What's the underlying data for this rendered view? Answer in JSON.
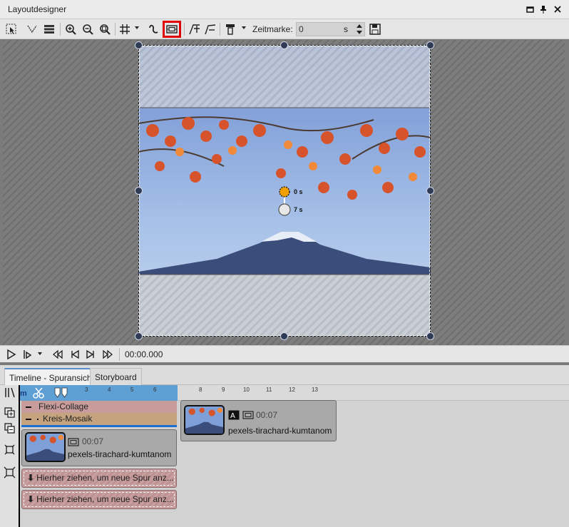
{
  "window": {
    "title": "Layoutdesigner",
    "controls": [
      "minimize-icon",
      "pin-icon",
      "close-icon"
    ]
  },
  "toolbar": {
    "zeitmarke_label": "Zeitmarke:",
    "zeitmarke_value": "0",
    "zeitmarke_unit": "s",
    "highlight_color": "#e00000",
    "highlighted_tool": "camera-pan-icon"
  },
  "canvas": {
    "anim_labels": [
      "0 s",
      "7 s"
    ],
    "selection_color": "#2f3a55"
  },
  "playback": {
    "timecode": "00:00.000"
  },
  "timeline": {
    "tabs": [
      {
        "label": "Timeline - Spuransicht",
        "active": true
      },
      {
        "label": "Storyboard",
        "active": false
      }
    ],
    "ruler_ticks": [
      "3",
      "4",
      "5",
      "6",
      "8",
      "9",
      "10",
      "11",
      "12",
      "13"
    ],
    "tracks": {
      "flexi": "Flexi-Collage",
      "kreis": "Kreis-Mosaik"
    },
    "clip_inner": {
      "time": "00:07",
      "name": "pexels-tirachard-kumtanom"
    },
    "clip_outer": {
      "time": "00:07",
      "name": "pexels-tirachard-kumtanom"
    },
    "dropzones": [
      "Hierher ziehen, um neue Spur anz...",
      "Hierher ziehen, um neue Spur anz..."
    ]
  }
}
